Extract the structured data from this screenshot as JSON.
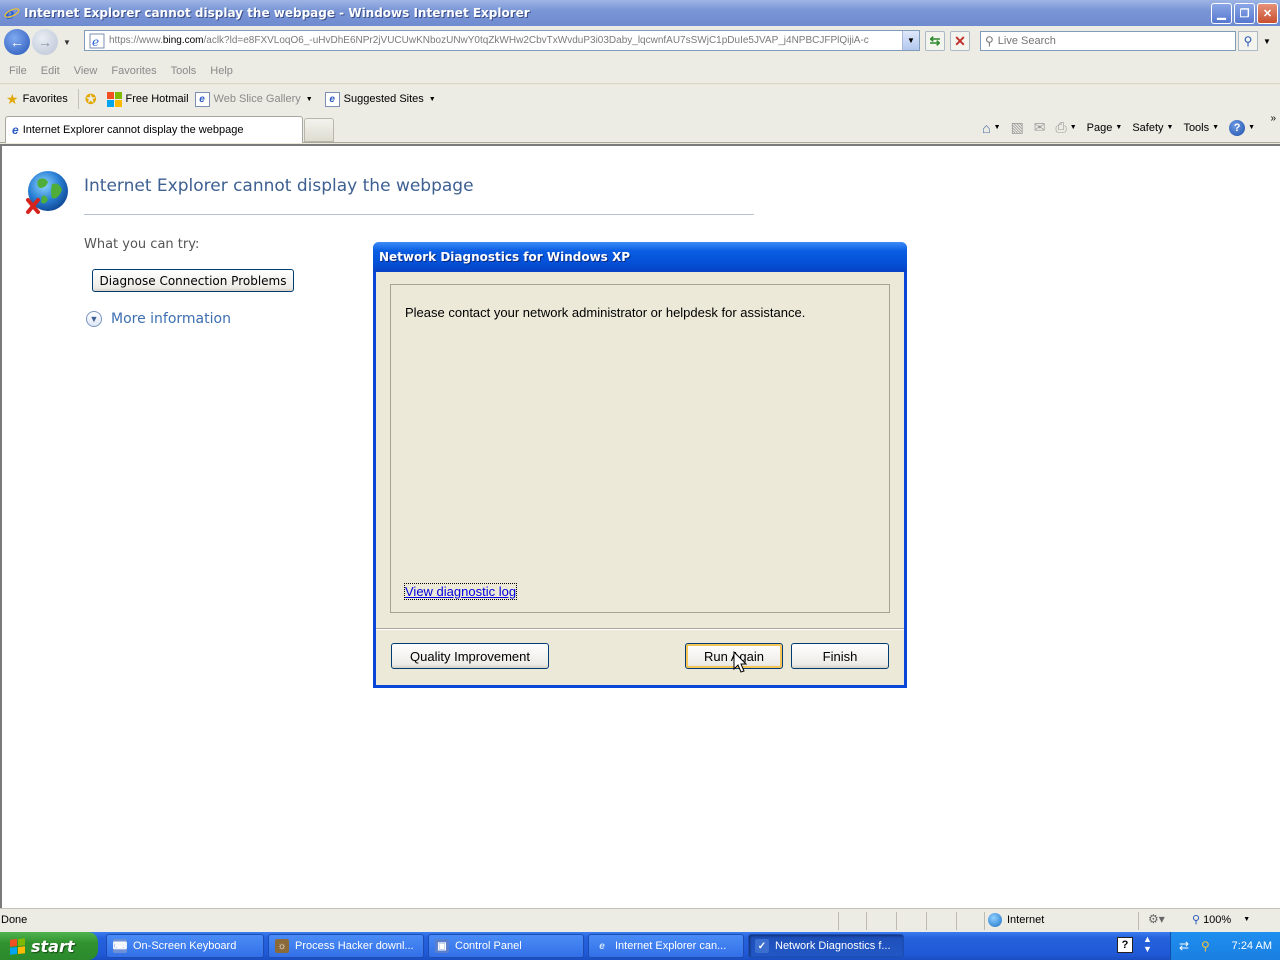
{
  "window": {
    "title": "Internet Explorer cannot display the webpage - Windows Internet Explorer",
    "min_label": "▁",
    "max_label": "❐",
    "close_label": "✕"
  },
  "address": {
    "url_prefix": "https://www.",
    "url_domain": "bing.com",
    "url_rest": "/aclk?ld=e8FXVLoqO6_-uHvDhE6NPr2jVUCUwKNbozUNwY0tqZkWHw2CbvTxWvduP3i03Daby_lqcwnfAU7sSWjC1pDuIe5JVAP_j4NPBCJFPlQijiA-c",
    "search_placeholder": "Live Search"
  },
  "menu": [
    "File",
    "Edit",
    "View",
    "Favorites",
    "Tools",
    "Help"
  ],
  "favorites": {
    "favorites_label": "Favorites",
    "hotmail_label": "Free Hotmail",
    "web_slice_label": "Web Slice Gallery",
    "suggested_label": "Suggested Sites"
  },
  "tab": {
    "title": "Internet Explorer cannot display the webpage"
  },
  "command_bar": {
    "page_label": "Page",
    "safety_label": "Safety",
    "tools_label": "Tools"
  },
  "content": {
    "heading": "Internet Explorer cannot display the webpage",
    "try_label": "What you can try:",
    "diagnose_button": "Diagnose Connection Problems",
    "more_info": "More information"
  },
  "dialog": {
    "title": "Network Diagnostics for Windows XP",
    "message": "Please contact your network administrator or helpdesk for assistance.",
    "log_link": "View diagnostic log",
    "quality_button": "Quality Improvement",
    "run_again_button": "Run Again",
    "finish_button": "Finish"
  },
  "status": {
    "text": "Done",
    "zone": "Internet",
    "zoom": "100%"
  },
  "taskbar": {
    "start_label": "start",
    "tasks": [
      {
        "label": "On-Screen Keyboard"
      },
      {
        "label": "Process Hacker downl..."
      },
      {
        "label": "Control Panel"
      },
      {
        "label": "Internet Explorer can..."
      },
      {
        "label": "Network Diagnostics f..."
      }
    ],
    "clock": "7:24 AM"
  },
  "colors": {
    "dialog_title": "#0a5ee3",
    "heading_text": "#3d5f91",
    "link_text": "#3d6fb0",
    "taskbar": "#2663dd",
    "start_button": "#2f922f"
  }
}
